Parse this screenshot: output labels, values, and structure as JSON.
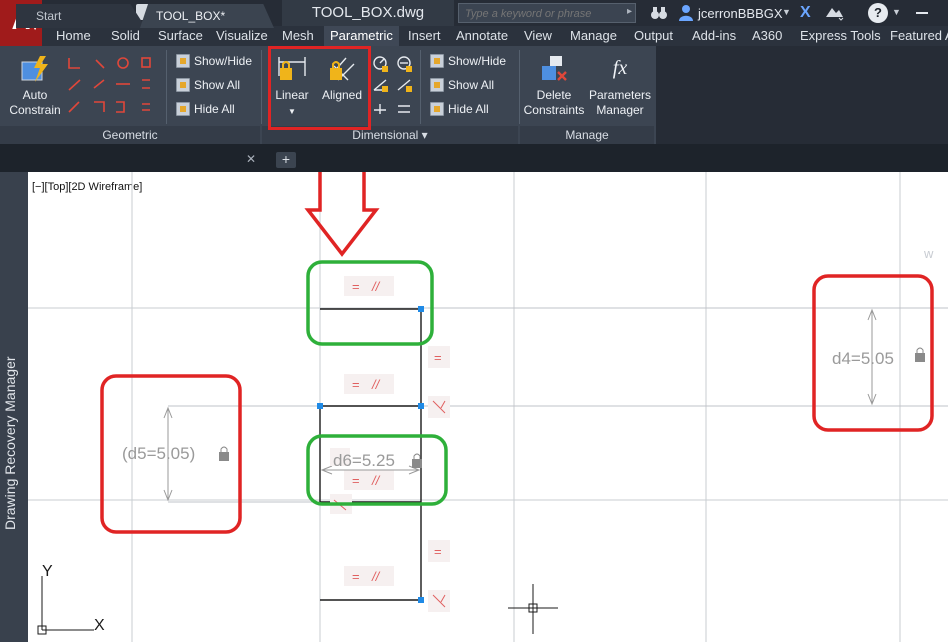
{
  "app": {
    "logo": "A",
    "document_title": "TOOL_BOX.dwg"
  },
  "search": {
    "placeholder": "Type a keyword or phrase"
  },
  "user": {
    "name": "jcerronBBBGX"
  },
  "help": {
    "label": "?"
  },
  "ribbon_tabs": [
    {
      "label": "Home"
    },
    {
      "label": "Solid"
    },
    {
      "label": "Surface"
    },
    {
      "label": "Visualize"
    },
    {
      "label": "Mesh"
    },
    {
      "label": "Parametric"
    },
    {
      "label": "Insert"
    },
    {
      "label": "Annotate"
    },
    {
      "label": "View"
    },
    {
      "label": "Manage"
    },
    {
      "label": "Output"
    },
    {
      "label": "Add-ins"
    },
    {
      "label": "A360"
    },
    {
      "label": "Express Tools"
    },
    {
      "label": "Featured A"
    }
  ],
  "ribbon": {
    "auto_constrain": {
      "line1": "Auto",
      "line2": "Constrain"
    },
    "geometric": {
      "show_hide": "Show/Hide",
      "show_all": "Show All",
      "hide_all": "Hide All",
      "title": "Geometric"
    },
    "dimensional": {
      "linear": "Linear",
      "aligned": "Aligned",
      "show_hide": "Show/Hide",
      "show_all": "Show All",
      "hide_all": "Hide All",
      "title": "Dimensional"
    },
    "manage": {
      "delete_line1": "Delete",
      "delete_line2": "Constraints",
      "params_line1": "Parameters",
      "params_line2": "Manager",
      "title": "Manage",
      "fx": "fx"
    }
  },
  "file_tabs": {
    "start": "Start",
    "current": "TOOL_BOX*"
  },
  "new_tab": "+",
  "drawing": {
    "viewport_label": "[−][Top][2D Wireframe]",
    "palette_title": "Drawing Recovery Manager",
    "constraints": {
      "d4": "d4=5.05",
      "d5": "(d5=5.05)",
      "d6": "d6=5.25"
    },
    "glyphs": {
      "equal": "=",
      "parallel": "//"
    },
    "axis": {
      "y": "Y",
      "x": "X"
    },
    "edge_char": "w"
  },
  "colors": {
    "accent": "#c41e1e",
    "annotation_red": "#e02424",
    "annotation_green": "#2eb03a",
    "grip_blue": "#1f8ae6",
    "constraint_text": "#9a9a9a",
    "glyph_red": "#e06060"
  },
  "icons": {
    "qat": [
      "new-icon",
      "open-icon",
      "save-icon",
      "save-as-icon",
      "plot-icon",
      "undo-icon",
      "redo-icon"
    ],
    "title": [
      "binoculars-icon",
      "user-icon",
      "exchange-icon",
      "cloud-icon",
      "help-icon"
    ]
  }
}
